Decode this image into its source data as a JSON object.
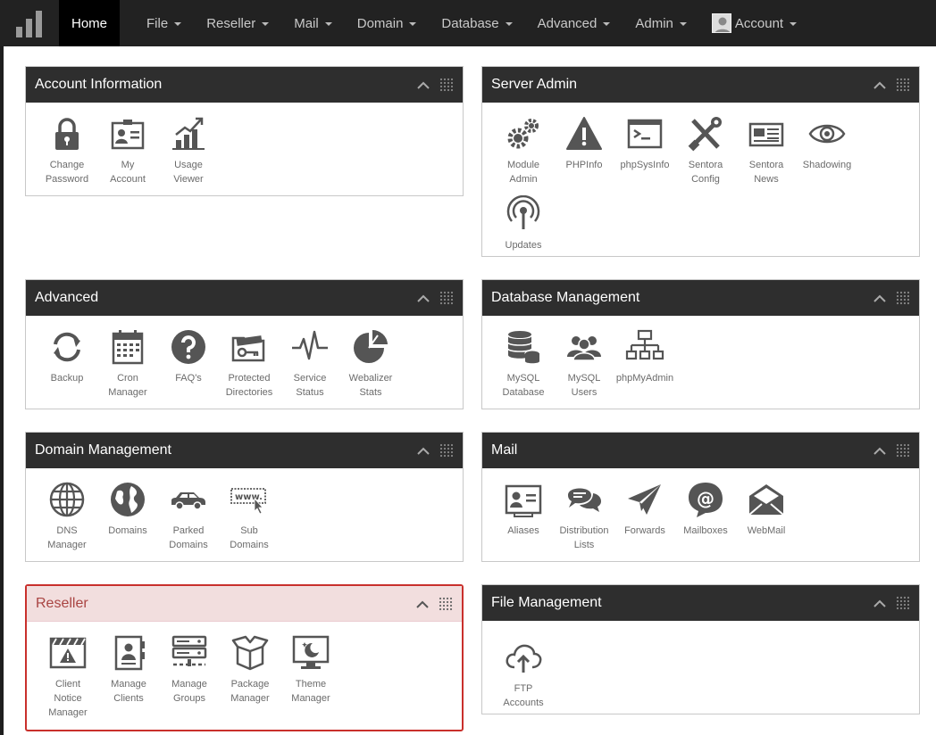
{
  "nav": {
    "items": [
      "Home",
      "File",
      "Reseller",
      "Mail",
      "Domain",
      "Database",
      "Advanced",
      "Admin"
    ],
    "account_label": "Account"
  },
  "panels": {
    "account_information": {
      "title": "Account Information",
      "modules": [
        "Change\nPassword",
        "My\nAccount",
        "Usage\nViewer"
      ]
    },
    "server_admin": {
      "title": "Server Admin",
      "modules": [
        "Module\nAdmin",
        "PHPInfo",
        "phpSysInfo",
        "Sentora\nConfig",
        "Sentora\nNews",
        "Shadowing",
        "Updates"
      ]
    },
    "advanced": {
      "title": "Advanced",
      "modules": [
        "Backup",
        "Cron\nManager",
        "FAQ's",
        "Protected\nDirectories",
        "Service\nStatus",
        "Webalizer\nStats"
      ]
    },
    "database_management": {
      "title": "Database Management",
      "modules": [
        "MySQL\nDatabase",
        "MySQL\nUsers",
        "phpMyAdmin"
      ]
    },
    "domain_management": {
      "title": "Domain Management",
      "modules": [
        "DNS\nManager",
        "Domains",
        "Parked\nDomains",
        "Sub\nDomains"
      ]
    },
    "mail": {
      "title": "Mail",
      "modules": [
        "Aliases",
        "Distribution\nLists",
        "Forwards",
        "Mailboxes",
        "WebMail"
      ]
    },
    "reseller": {
      "title": "Reseller",
      "modules": [
        "Client\nNotice\nManager",
        "Manage\nClients",
        "Manage\nGroups",
        "Package\nManager",
        "Theme\nManager"
      ]
    },
    "file_management": {
      "title": "File Management",
      "modules": [
        "FTP\nAccounts"
      ]
    }
  },
  "colors": {
    "icon": "#555555",
    "navbar": "#222222",
    "panel_header": "#2e2e2e",
    "alert_border": "#c9302c"
  }
}
